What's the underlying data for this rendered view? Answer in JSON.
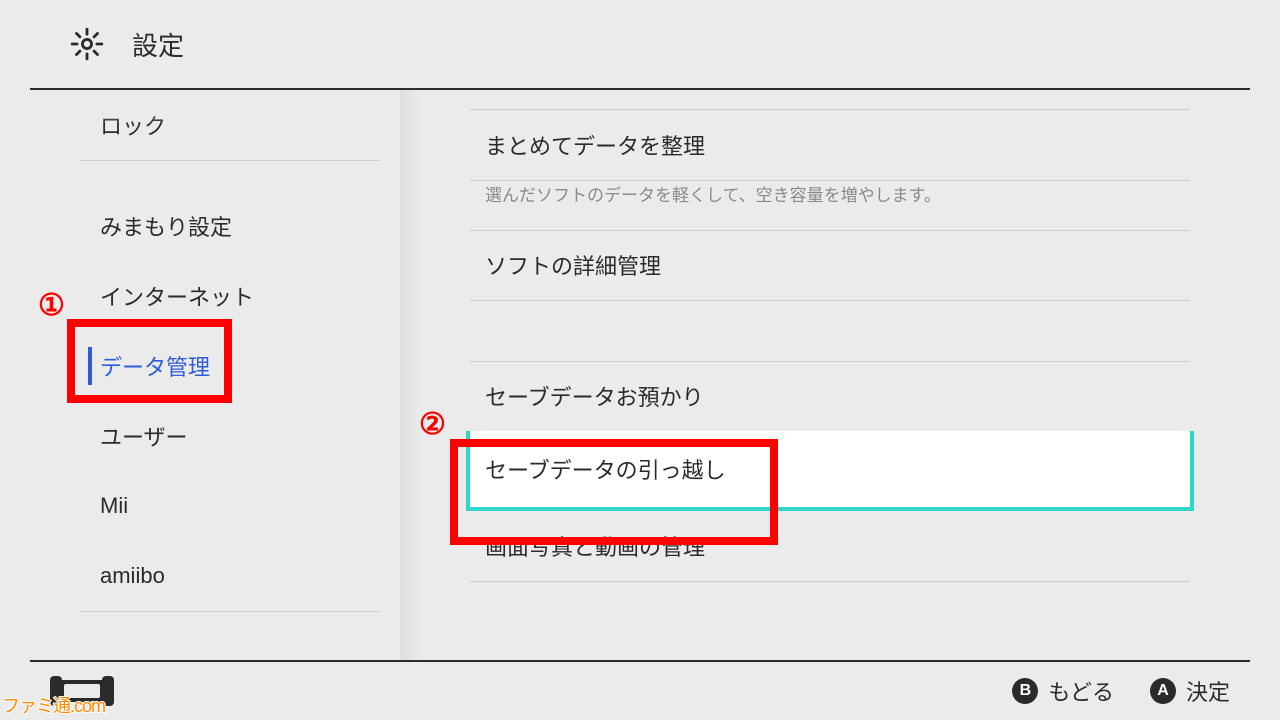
{
  "header": {
    "title": "設定"
  },
  "sidebar": {
    "items": [
      {
        "label": "ロック"
      },
      {
        "label": "みまもり設定"
      },
      {
        "label": "インターネット"
      },
      {
        "label": "データ管理",
        "selected": true
      },
      {
        "label": "ユーザー"
      },
      {
        "label": "Mii"
      },
      {
        "label": "amiibo"
      }
    ]
  },
  "content": {
    "rows": [
      {
        "label": "まとめてデータを整理"
      },
      {
        "label": "ソフトの詳細管理"
      },
      {
        "label": "セーブデータお預かり"
      },
      {
        "label": "セーブデータの引っ越し",
        "highlighted": true
      },
      {
        "label": "画面写真と動画の管理"
      }
    ],
    "desc1": "選んだソフトのデータを軽くして、空き容量を増やします。"
  },
  "footer": {
    "b_label": "もどる",
    "a_label": "決定"
  },
  "annotations": {
    "num1": "①",
    "num2": "②",
    "watermark": "ファミ通.com"
  }
}
